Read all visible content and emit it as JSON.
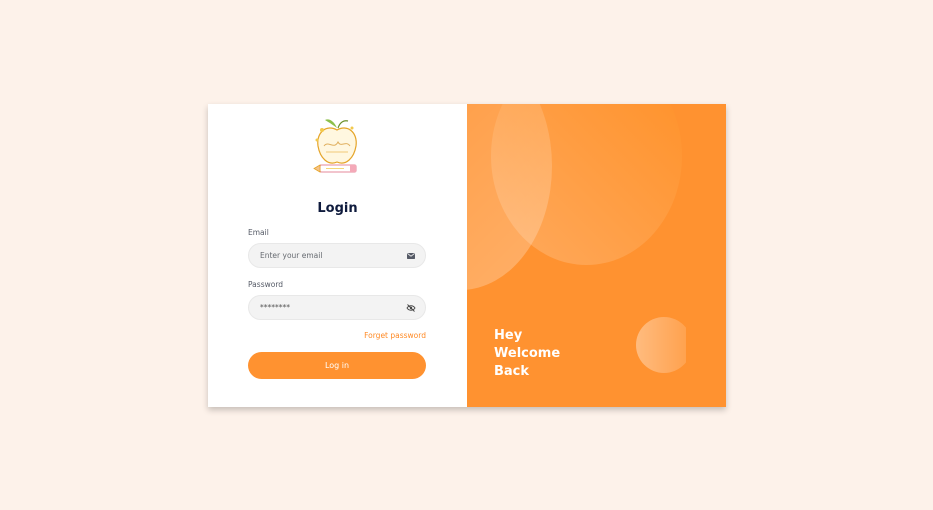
{
  "login": {
    "logo_name": "apple-pencil-logo",
    "title": "Login",
    "email_label": "Email",
    "email_placeholder": "Enter your email",
    "email_icon": "envelope-icon",
    "password_label": "Password",
    "password_value": "********",
    "password_icon": "eye-slash-icon",
    "forgot_label": "Forget password",
    "button_label": "Log in"
  },
  "welcome": {
    "line1": "Hey",
    "line2": "Welcome",
    "line3": "Back"
  },
  "colors": {
    "accent": "#ff9230",
    "background": "#fdf2ea",
    "title": "#0f1b3d"
  }
}
